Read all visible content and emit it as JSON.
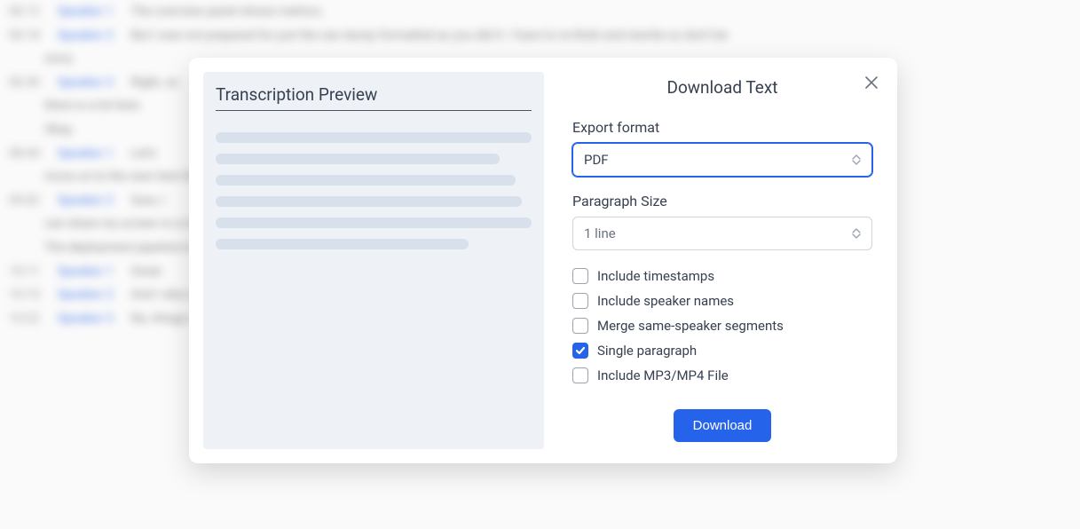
{
  "background": {
    "rows": [
      {
        "speaker": "Speaker 1",
        "time": "06:12",
        "text": "The overview panel shows metrics."
      },
      {
        "speaker": "Speaker 2",
        "time": "06:18",
        "text": "But I was not prepared for just the raw dump formatted as you did it. I have to re-think and rewrite so don't be"
      },
      {
        "speaker": "",
        "time": "",
        "text": "sorry."
      },
      {
        "speaker": "Speaker 3",
        "time": "06:30",
        "text": "Right, so"
      },
      {
        "speaker": "",
        "time": "",
        "text": "there is a lot here."
      },
      {
        "speaker": "",
        "time": "",
        "text": "Okay."
      },
      {
        "speaker": "Speaker 1",
        "time": "08:44",
        "text": "Let's"
      },
      {
        "speaker": "",
        "time": "",
        "text": "move on to the next item then."
      },
      {
        "speaker": "Speaker 2",
        "time": "09:02",
        "text": "Sure, I"
      },
      {
        "speaker": "",
        "time": "",
        "text": "can share my screen in a moment and walk through it."
      },
      {
        "speaker": "",
        "time": "",
        "text": "The deployment pipeline is almost finished, just a couple more reviews."
      },
      {
        "speaker": "Speaker 1",
        "time": "10:11",
        "text": "Great."
      },
      {
        "speaker": "Speaker 2",
        "time": "10:15",
        "text": "And I also updated the readme, but if you see anything incorrect, that would be of interest."
      },
      {
        "speaker": "Speaker 3",
        "time": "10:22",
        "text": "No, things will be okay."
      }
    ]
  },
  "modal": {
    "preview_title": "Transcription Preview",
    "title": "Download Text",
    "export_format_label": "Export format",
    "export_format_value": "PDF",
    "paragraph_size_label": "Paragraph Size",
    "paragraph_size_value": "1 line",
    "options": [
      {
        "key": "timestamps",
        "label": "Include timestamps",
        "checked": false
      },
      {
        "key": "speaker_names",
        "label": "Include speaker names",
        "checked": false
      },
      {
        "key": "merge_segments",
        "label": "Merge same-speaker segments",
        "checked": false
      },
      {
        "key": "single_paragraph",
        "label": "Single paragraph",
        "checked": true
      },
      {
        "key": "include_media",
        "label": "Include MP3/MP4 File",
        "checked": false
      }
    ],
    "download_button": "Download"
  }
}
